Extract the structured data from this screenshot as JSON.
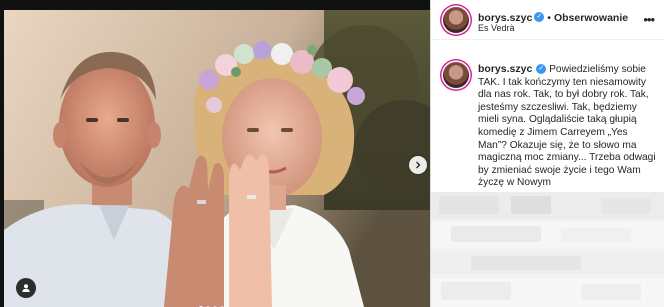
{
  "header": {
    "username": "borys.szyc",
    "separator": "•",
    "follow_label": "Obserwowanie",
    "location": "Es Vedrà",
    "more_icon": "ellipsis-icon"
  },
  "caption": {
    "username": "borys.szyc",
    "text": "Powiedzieliśmy sobie TAK. I tak kończymy ten niesamowity dla nas rok. Tak, to był dobry rok. Tak, jesteśmy szczesliwi. Tak, będziemy mieli syna. Oglądaliście taką głupią komedię z Jimem Carreyem „Yes Man”? Okazuje się, że to słowo ma magiczną moc zmiany... Trzeba odwagi by zmieniać swoje życie i tego Wam życzę w Nowym"
  },
  "media": {
    "next_icon": "chevron-right-icon",
    "tag_icon": "user-tag-icon",
    "carousel_count": 4,
    "carousel_active": 1
  },
  "colors": {
    "verified": "#3897f0",
    "story_ring": "#d6249f",
    "text": "#262626"
  }
}
